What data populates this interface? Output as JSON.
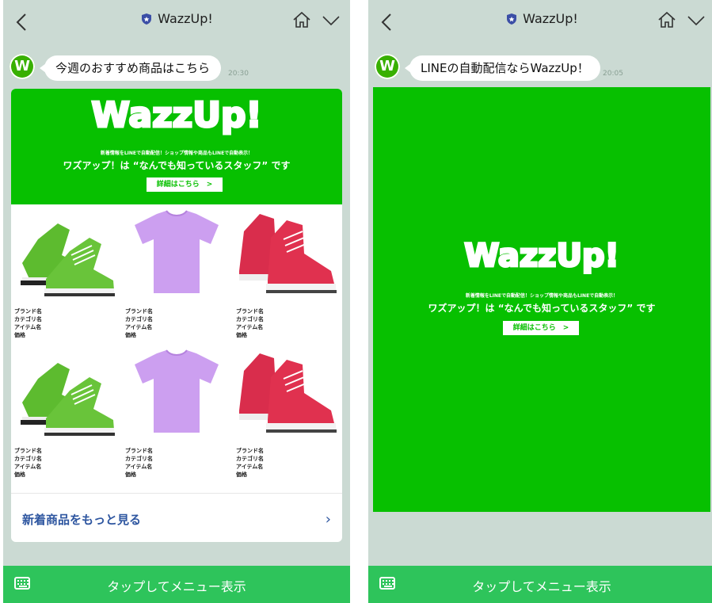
{
  "header": {
    "title": "WazzUp!"
  },
  "left": {
    "message": "今週のおすすめ商品はこちら",
    "time": "20:30",
    "hero": {
      "logo": "WazzUp!",
      "line1": "新着情報をLINEで自動配信！ショップ情報や商品もLINEで自動表示！",
      "line2": "ワズアップ！は “なんでも知っているスタッフ” です",
      "button": "詳細はこちら　>"
    },
    "products": [
      {
        "image": "green-sneakers",
        "brand": "ブランド名",
        "category": "カテゴリ名",
        "item": "アイテム名",
        "price": "価格"
      },
      {
        "image": "purple-tshirt",
        "brand": "ブランド名",
        "category": "カテゴリ名",
        "item": "アイテム名",
        "price": "価格"
      },
      {
        "image": "red-sneakers",
        "brand": "ブランド名",
        "category": "カテゴリ名",
        "item": "アイテム名",
        "price": "価格"
      },
      {
        "image": "green-sneakers",
        "brand": "ブランド名",
        "category": "カテゴリ名",
        "item": "アイテム名",
        "price": "価格"
      },
      {
        "image": "purple-tshirt",
        "brand": "ブランド名",
        "category": "カテゴリ名",
        "item": "アイテム名",
        "price": "価格"
      },
      {
        "image": "red-sneakers",
        "brand": "ブランド名",
        "category": "カテゴリ名",
        "item": "アイテム名",
        "price": "価格"
      }
    ],
    "more_label": "新着商品をもっと見る",
    "more_arrow": "›"
  },
  "right": {
    "message": "LINEの自動配信ならWazzUp！",
    "time": "20:05",
    "card": {
      "logo": "WazzUp!",
      "line1": "新着情報をLINEで自動配信！ショップ情報や商品もLINEで自動表示！",
      "line2": "ワズアップ！は “なんでも知っているスタッフ” です",
      "button": "詳細はこちら　>"
    }
  },
  "menu": {
    "label": "タップしてメニュー表示"
  },
  "colors": {
    "line_green": "#07c000",
    "menu_green": "#2ec45b",
    "chat_bg": "#cbdad3",
    "link_blue": "#2e56a0"
  },
  "icons": [
    "back-chevron-icon",
    "shield-icon",
    "home-icon",
    "chevron-down-icon",
    "keyboard-icon",
    "sneaker-image",
    "tshirt-image"
  ]
}
